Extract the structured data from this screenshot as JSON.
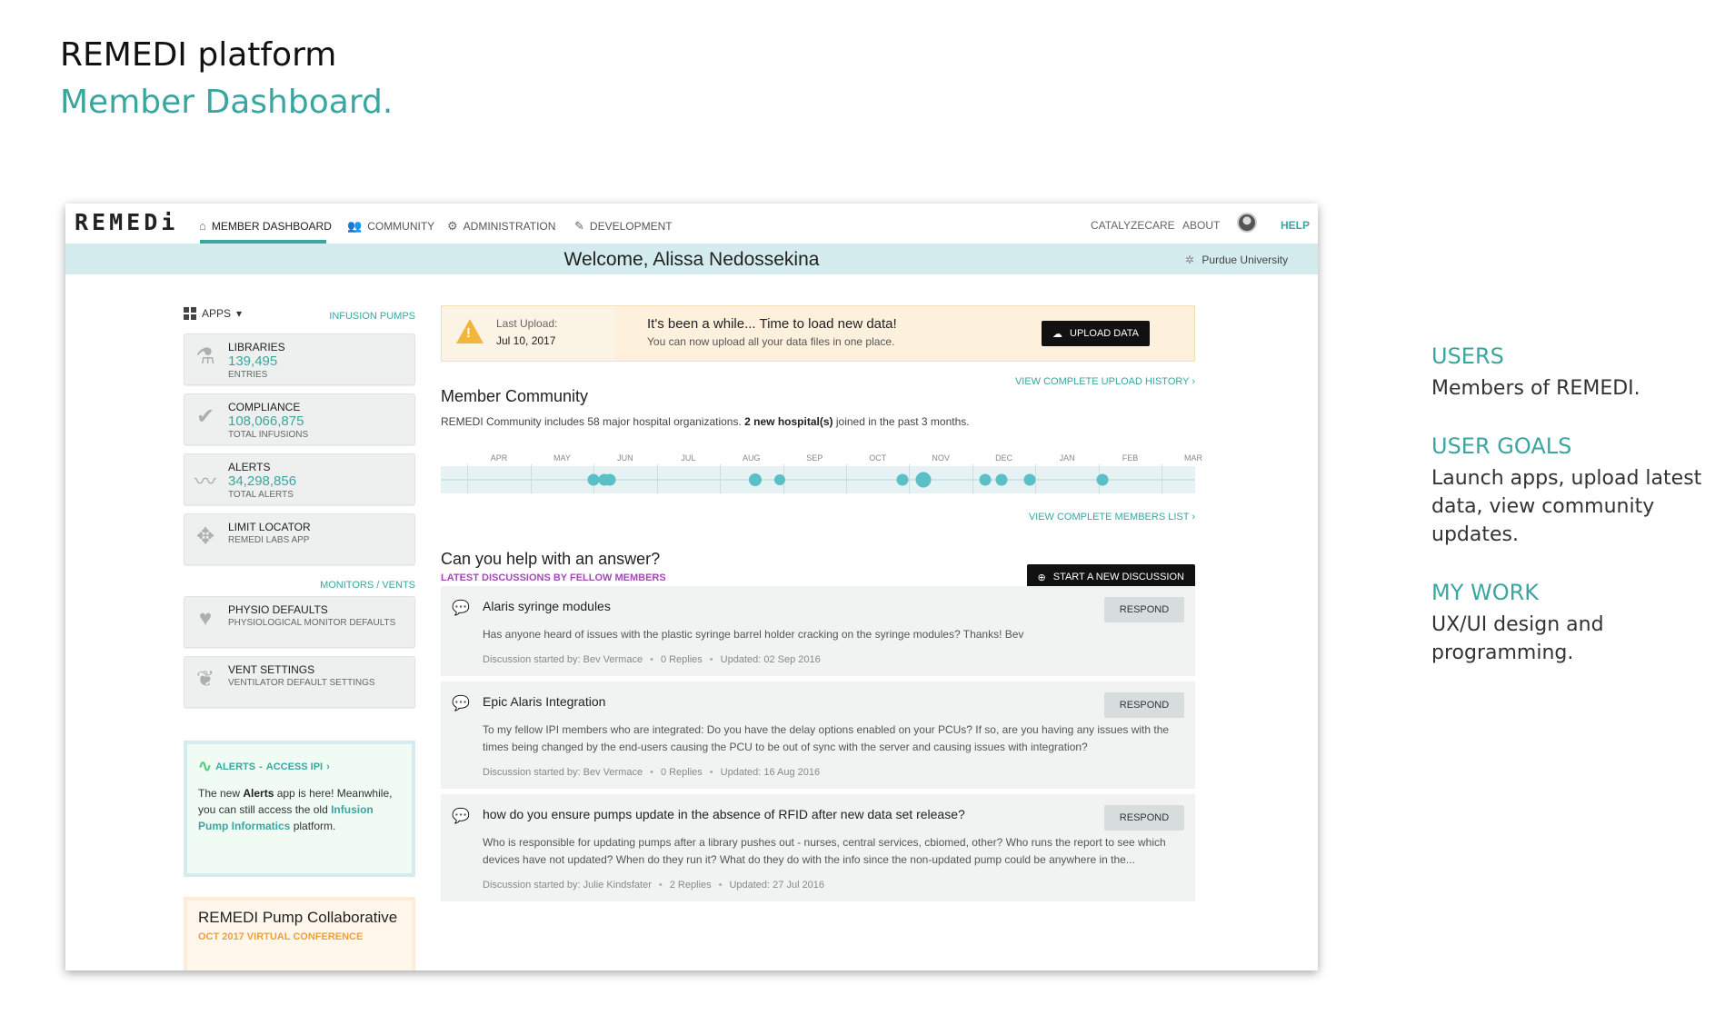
{
  "header": {
    "title": "REMEDI platform",
    "subtitle": "Member Dashboard."
  },
  "notes": [
    {
      "heading": "USERS",
      "body": "Members of REMEDI."
    },
    {
      "heading": "USER GOALS",
      "body": "Launch apps, upload latest data, view community updates."
    },
    {
      "heading": "MY WORK",
      "body": "UX/UI design and programming."
    }
  ],
  "app": {
    "logo": "REMEDi",
    "nav": {
      "dashboard": "MEMBER DASHBOARD",
      "community": "COMMUNITY",
      "administration": "ADMINISTRATION",
      "development": "DEVELOPMENT",
      "catalyzecare": "CATALYZECARE",
      "about": "ABOUT",
      "help": "HELP"
    },
    "welcome": "Welcome, Alissa Nedossekina",
    "org": "Purdue University",
    "sidebar": {
      "apps_label": "APPS",
      "section_infusion": "INFUSION PUMPS",
      "infusion_apps": [
        {
          "name": "LIBRARIES",
          "value": "139,495",
          "sub": "ENTRIES",
          "icon": "flask-icon"
        },
        {
          "name": "COMPLIANCE",
          "value": "108,066,875",
          "sub": "TOTAL INFUSIONS",
          "icon": "checkmark-icon"
        },
        {
          "name": "ALERTS",
          "value": "34,298,856",
          "sub": "TOTAL ALERTS",
          "icon": "pulse-icon"
        },
        {
          "name": "LIMIT LOCATOR",
          "sub": "REMEDI LABS APP",
          "icon": "locator-icon"
        }
      ],
      "section_monitors": "MONITORS / VENTS",
      "monitor_apps": [
        {
          "name": "PHYSIO DEFAULTS",
          "sub": "PHYSIOLOGICAL MONITOR DEFAULTS",
          "icon": "heart-icon"
        },
        {
          "name": "VENT SETTINGS",
          "sub": "VENTILATOR DEFAULT SETTINGS",
          "icon": "lungs-icon"
        }
      ],
      "alert_card": {
        "title_alerts": "ALERTS",
        "title_link": "ACCESS IPI",
        "text_1": "The new ",
        "text_bold": "Alerts",
        "text_2": " app is here! Meanwhile, you can still access the old ",
        "text_link": "Infusion Pump Informatics",
        "text_3": " platform."
      },
      "pump_card": {
        "title": "REMEDI Pump Collaborative",
        "sub": "OCT 2017 VIRTUAL CONFERENCE"
      }
    },
    "upload": {
      "last_label": "Last Upload:",
      "last_date": "Jul 10, 2017",
      "headline": "It's been a while... Time to load new data!",
      "message": "You can now upload all your data files in one place.",
      "button": "UPLOAD DATA"
    },
    "upload_history_link": "VIEW COMPLETE UPLOAD HISTORY",
    "community": {
      "title": "Member Community",
      "text_1": "REMEDI Community includes 58 major hospital organizations. ",
      "text_bold": "2 new hospital(s)",
      "text_2": " joined in the past 3 months.",
      "months": [
        "APR",
        "MAY",
        "JUN",
        "JUL",
        "AUG",
        "SEP",
        "OCT",
        "NOV",
        "DEC",
        "JAN",
        "FEB",
        "MAR"
      ],
      "members_link": "VIEW COMPLETE MEMBERS LIST"
    },
    "discussions": {
      "title": "Can you help with an answer?",
      "subtitle": "LATEST DISCUSSIONS BY FELLOW MEMBERS",
      "start_button": "START A NEW DISCUSSION",
      "respond_label": "RESPOND",
      "items": [
        {
          "title": "Alaris syringe modules",
          "body": "Has anyone heard of issues with the plastic syringe barrel holder cracking on the syringe modules? Thanks! Bev",
          "started": "Discussion started by: Bev Vermace",
          "replies": "0 Replies",
          "updated": "Updated: 02 Sep 2016"
        },
        {
          "title": "Epic Alaris Integration",
          "body": "To my fellow IPI members who are integrated: Do you have the delay options enabled on your PCUs? If so, are you having any issues with the times being changed by the end-users causing the PCU to be out of sync with the server and causing issues with integration?",
          "started": "Discussion started by: Bev Vermace",
          "replies": "0 Replies",
          "updated": "Updated: 16 Aug 2016"
        },
        {
          "title": "how do you ensure pumps update in the absence of RFID after new data set release?",
          "body": "Who is responsible for updating pumps after a library pushes out - nurses, central services, cbiomed, other? Who runs the report to see which devices have not updated? When do they run it? What do they do with the info since the non-updated pump could be anywhere in the...",
          "started": "Discussion started by: Julie Kindsfater",
          "replies": "2 Replies",
          "updated": "Updated: 27 Jul 2016"
        }
      ]
    }
  }
}
